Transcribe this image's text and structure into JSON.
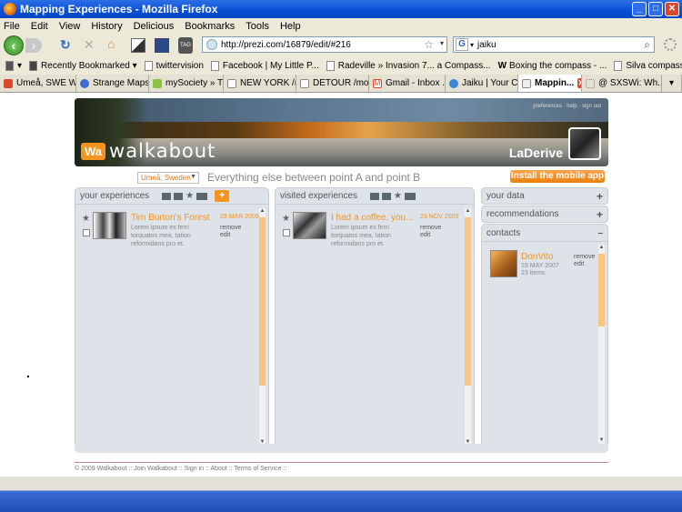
{
  "window": {
    "title": "Mapping Experiences - Mozilla Firefox"
  },
  "menu": [
    "File",
    "Edit",
    "View",
    "History",
    "Delicious",
    "Bookmarks",
    "Tools",
    "Help"
  ],
  "nav": {
    "url": "http://prezi.com/16879/edit/#216",
    "search": "jaiku"
  },
  "bookmarks": [
    "Recently Bookmarked",
    "twittervision",
    "Facebook | My Little P...",
    "Radeville » Invasion 7... a Compass...",
    "Boxing the compass - ...",
    "Silva compass - Wikipe..."
  ],
  "tabs": [
    {
      "label": "Umeå, SWE W...",
      "color": "#d9472c"
    },
    {
      "label": "Strange Maps",
      "color": "#3a6cd3"
    },
    {
      "label": "mySociety » T...",
      "color": "#8ac43f"
    },
    {
      "label": "NEW YORK /m...",
      "color": "#fff"
    },
    {
      "label": "DETOUR /mol...",
      "color": "#fff"
    },
    {
      "label": "Gmail - Inbox ...",
      "color": "#d9472c"
    },
    {
      "label": "Jaiku | Your C...",
      "color": "#3a88d3"
    },
    {
      "label": "Mappin...",
      "color": "#ddd"
    },
    {
      "label": "@ SXSWi: Wh...",
      "color": "#888"
    }
  ],
  "site": {
    "logo_badge": "Wa",
    "logo_text": "walkabout",
    "header_links": "preferences · help · sign out",
    "username": "LaDerive",
    "location": "Umeå, Sweden",
    "tagline": "Everything else between point A and point B",
    "mobile_cta": "Install the mobile app"
  },
  "your_experiences": {
    "title": "your experiences",
    "item": {
      "title": "Tim Burton's Forest",
      "date": "29 MAR 2009",
      "desc": "Lorem ipsum ex ferri torquatos mea, tation reformidans pro et.",
      "remove": "remove",
      "edit": "edit"
    }
  },
  "visited_experiences": {
    "title": "visited experiences",
    "item": {
      "title": "I had a coffee, you...",
      "date": "23 NOV 2005",
      "desc": "Lorem ipsum ex ferri torquatos mea, tation reformidans pro et.",
      "remove": "remove",
      "edit": "edit"
    }
  },
  "right": {
    "your_data": "your data",
    "recommendations": "recommendations",
    "contacts": "contacts",
    "contact": {
      "name": "DonVito",
      "date": "19 MAY 2007",
      "items": "23 items",
      "remove": "remove",
      "edit": "edit"
    }
  },
  "footer": "© 2009 Walkabout :: Join Walkabout :: Sign in :: About :: Terms of Service ::"
}
